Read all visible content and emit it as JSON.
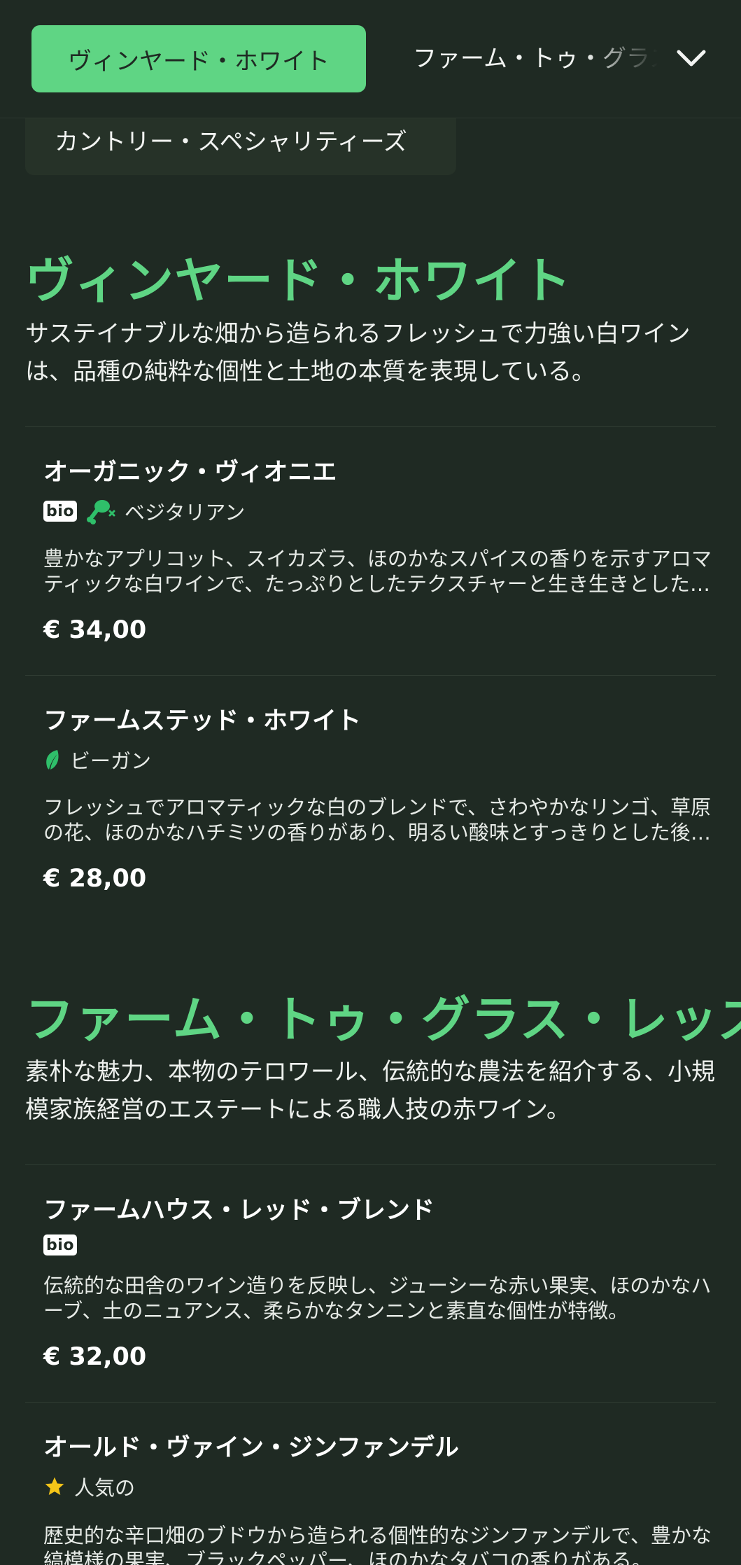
{
  "categories": {
    "active": "ヴィンヤード・ホワイト",
    "next": "ファーム・トゥ・グラス・レッズ",
    "secondary": "カントリー・スペシャリティーズ"
  },
  "sections": [
    {
      "title": "ヴィンヤード・ホワイト",
      "description": "サステイナブルな畑から造られるフレッシュで力強い白ワインは、品種の純粋な個性と土地の本質を表現している。",
      "items": [
        {
          "name": "オーガニック・ヴィオニエ",
          "badge": "bio",
          "diet_label": "ベジタリアン",
          "description": "豊かなアプリコット、スイカズラ、ほのかなスパイスの香りを示すアロマティックな白ワインで、たっぷりとしたテクスチャーと生き生きとした余韻がある。",
          "price": "€ 34,00"
        },
        {
          "name": "ファームステッド・ホワイト",
          "diet_label": "ビーガン",
          "description": "フレッシュでアロマティックな白のブレンドで、さわやかなリンゴ、草原の花、ほのかなハチミツの香りがあり、明るい酸味とすっきりとした後味。",
          "price": "€ 28,00"
        }
      ]
    },
    {
      "title": "ファーム・トゥ・グラス・レッズ",
      "description": "素朴な魅力、本物のテロワール、伝統的な農法を紹介する、小規模家族経営のエステートによる職人技の赤ワイン。",
      "items": [
        {
          "name": "ファームハウス・レッド・ブレンド",
          "badge": "bio",
          "description": "伝統的な田舎のワイン造りを反映し、ジューシーな赤い果実、ほのかなハーブ、土のニュアンス、柔らかなタンニンと素直な個性が特徴。",
          "price": "€ 32,00"
        },
        {
          "name": "オールド・ヴァイン・ジンファンデル",
          "popular_label": "人気の",
          "description": "歴史的な辛口畑のブドウから造られる個性的なジンファンデルで、豊かな縞模様の果実、ブラックペッパー、ほのかなタバコの香りがある。",
          "price": ""
        }
      ]
    }
  ],
  "colors": {
    "background": "#1f2a23",
    "accent": "#5fd584",
    "diet_icon": "#2fbf6a",
    "star": "#f5c518"
  },
  "icons": {
    "chevron": "chevron-down-icon",
    "vegetarian": "drumstick-crossed-icon",
    "vegan": "leaf-icon",
    "popular": "star-icon"
  }
}
